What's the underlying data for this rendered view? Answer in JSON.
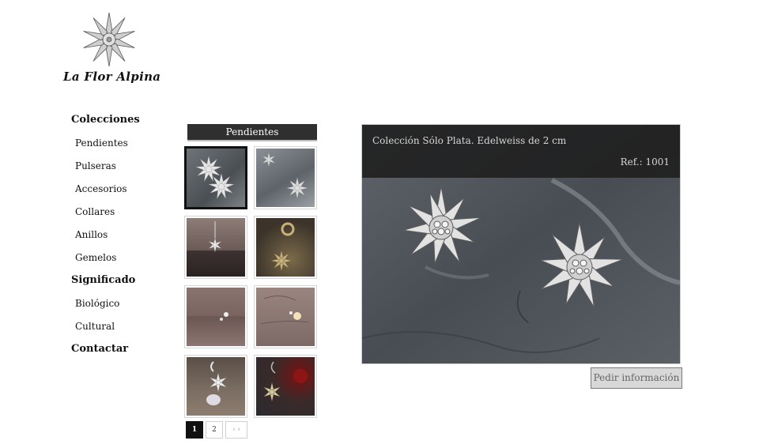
{
  "brand": {
    "name": "La Flor Alpina"
  },
  "nav": {
    "sections": [
      {
        "label": "Colecciones",
        "items": [
          "Pendientes",
          "Pulseras",
          "Accesorios",
          "Collares",
          "Anillos",
          "Gemelos"
        ]
      },
      {
        "label": "Significado",
        "items": [
          "Biológico",
          "Cultural"
        ]
      },
      {
        "label": "Contactar",
        "items": []
      }
    ]
  },
  "gallery": {
    "title": "Pendientes",
    "selected_index": 0,
    "thumbs": [
      {
        "alt": "edelweiss-studs-slate"
      },
      {
        "alt": "edelweiss-small-slate"
      },
      {
        "alt": "edelweiss-dangle-box"
      },
      {
        "alt": "edelweiss-dangle-gold"
      },
      {
        "alt": "earring-brown-box"
      },
      {
        "alt": "earring-pink-box"
      },
      {
        "alt": "edelweiss-crystal-drop"
      },
      {
        "alt": "edelweiss-red-bead"
      }
    ],
    "pager": {
      "pages": [
        "1",
        "2"
      ],
      "current": "1",
      "next": "› ›"
    }
  },
  "viewer": {
    "caption": "Colección Sólo Plata. Edelweiss de 2 cm",
    "ref": "Ref.: 1001",
    "request_button": "Pedir información"
  }
}
